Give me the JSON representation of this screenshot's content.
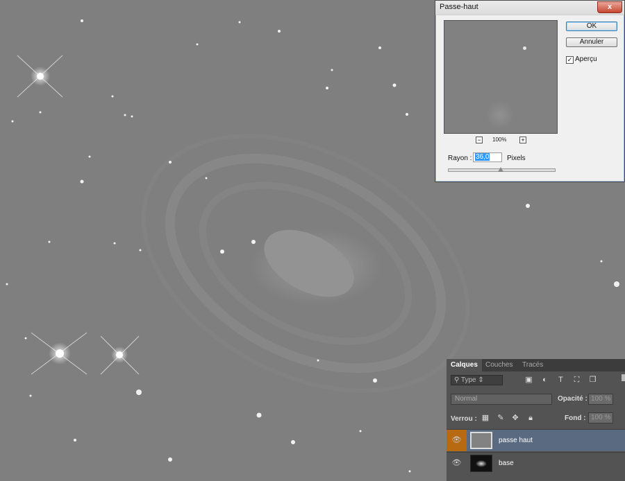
{
  "dialog": {
    "title": "Passe-haut",
    "close_glyph": "x",
    "zoom_level": "100%",
    "zoom_minus": "−",
    "zoom_plus": "+",
    "radius_label": "Rayon :",
    "radius_value": "36,0",
    "radius_unit": "Pixels",
    "slider_value": 0.5,
    "ok_label": "OK",
    "cancel_label": "Annuler",
    "preview_label": "Aperçu",
    "preview_checked": true
  },
  "layers_panel": {
    "tabs": [
      "Calques",
      "Couches",
      "Tracés"
    ],
    "filter": "Type",
    "filter_icons": [
      "image-icon",
      "adjustment-icon",
      "type-icon",
      "shape-icon",
      "smart-object-icon"
    ],
    "blend_mode": "Normal",
    "opacity_label": "Opacité :",
    "opacity_value": "100 %",
    "lock_label": "Verrou :",
    "lock_icons": [
      "lock-pixels-icon",
      "lock-paint-icon",
      "lock-move-icon",
      "lock-all-icon"
    ],
    "fill_label": "Fond :",
    "fill_value": "100 %",
    "layers": [
      {
        "name": "passe haut",
        "selected": true
      },
      {
        "name": "base",
        "selected": false
      }
    ]
  },
  "colors": {
    "canvas_gray": "#7f7f7f",
    "selected_layer": "#5a6a80",
    "eye_highlight": "#b86a12"
  }
}
